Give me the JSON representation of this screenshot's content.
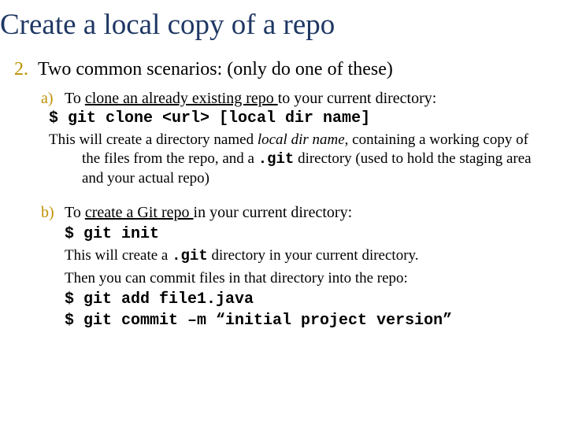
{
  "title": "Create a local copy of a repo",
  "item2": {
    "marker": "2.",
    "text": "Two common scenarios: (only do one of these)"
  },
  "a": {
    "marker": "a)",
    "lead": "To ",
    "underlined": "clone an already existing repo ",
    "tail": "to your current directory:",
    "cmd": "$ git clone <url> [local dir name]",
    "desc_pre": "This will create a directory named ",
    "desc_local": "local dir name",
    "desc_mid": ", containing  a working copy  of the files from the repo, and a ",
    "desc_git": ".git",
    "desc_post": "  directory (used to hold the staging area and your actual repo)"
  },
  "b": {
    "marker": "b)",
    "lead": "To ",
    "underlined": "create a Git repo ",
    "tail": "in your current directory:",
    "cmd1": "$ git init",
    "desc1_pre": "This will create a ",
    "desc1_git": ".git",
    "desc1_post": "  directory in your current directory.",
    "desc2": "Then you can commit files in that directory into the repo:",
    "cmd2": "$ git add file1.java",
    "cmd3": "$ git commit –m “initial project version”"
  }
}
